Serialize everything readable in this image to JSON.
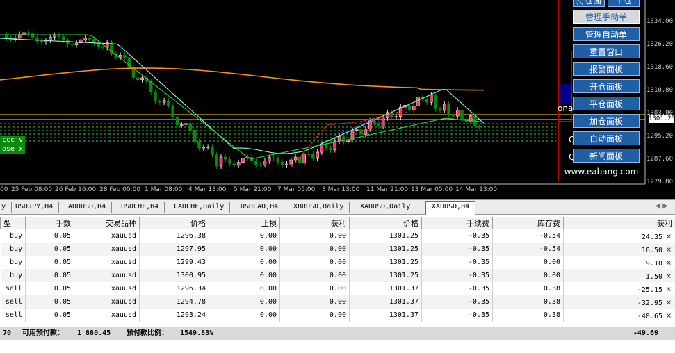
{
  "chart": {
    "price_ticks": [
      "1334.00",
      "1326.20",
      "1318.60",
      "1310.80",
      "1303.00",
      "1295.20",
      "1287.60",
      "1279.80"
    ],
    "current_price": "1301.25",
    "time_ticks": [
      "00",
      "25 Feb 08:00",
      "26 Feb 16:00",
      "28 Feb 00:00",
      "1 Mar 08:00",
      "4 Mar 13:00",
      "5 Mar 21:00",
      "7 Mar 05:00",
      "8 Mar 13:00",
      "11 Mar 21:00",
      "13 Mar 05:00",
      "14 Mar 13:00"
    ],
    "green_tag_top": "ccc v",
    "green_tag_bottom": "ose x",
    "colors": {
      "up": "#e8e8e8",
      "down": "#0a8a0a",
      "ma_fast": "#7fffd4",
      "ma_mid": "#32cd32",
      "ma_slow": "#ff8c1a",
      "level": "#ffd700"
    }
  },
  "panel": {
    "top_buttons": [
      "持仓面",
      "平仓"
    ],
    "buttons": [
      "管理手动单",
      "管理自动单",
      "重置窗口",
      "报警面板",
      "开仓面板",
      "平仓面板",
      "加仓面板",
      "自动面板",
      "新闻面板"
    ],
    "side_text_1": "ona",
    "side_text_2": "Q",
    "side_text_3": "Q",
    "url": "www.eabang.com"
  },
  "tabs": [
    "y",
    "USDJPY,H4",
    "AUDUSD,H4",
    "USDCHF,H4",
    "CADCHF,Daily",
    "USDCAD,H4",
    "XBRUSD,Daily",
    "XAUUSD,Daily",
    "XAUUSD,H4"
  ],
  "tab_arrows": "◀ ▶",
  "table": {
    "columns": [
      "型",
      "手数",
      "交易品种",
      "价格",
      "止损",
      "获利",
      "价格",
      "手续费",
      "库存费",
      "获利"
    ],
    "rows": [
      [
        "buy",
        "0.05",
        "xauusd",
        "1296.38",
        "0.00",
        "0.00",
        "1301.25",
        "-0.35",
        "-0.54",
        "24.35"
      ],
      [
        "buy",
        "0.05",
        "xauusd",
        "1297.95",
        "0.00",
        "0.00",
        "1301.25",
        "-0.35",
        "-0.54",
        "16.50"
      ],
      [
        "buy",
        "0.05",
        "xauusd",
        "1299.43",
        "0.00",
        "0.00",
        "1301.25",
        "-0.35",
        "0.00",
        "9.10"
      ],
      [
        "buy",
        "0.05",
        "xauusd",
        "1300.95",
        "0.00",
        "0.00",
        "1301.25",
        "-0.35",
        "0.00",
        "1.50"
      ],
      [
        "sell",
        "0.05",
        "xauusd",
        "1296.34",
        "0.00",
        "0.00",
        "1301.37",
        "-0.35",
        "0.38",
        "-25.15"
      ],
      [
        "sell",
        "0.05",
        "xauusd",
        "1294.78",
        "0.00",
        "0.00",
        "1301.37",
        "-0.35",
        "0.38",
        "-32.95"
      ],
      [
        "sell",
        "0.05",
        "xauusd",
        "1293.24",
        "0.00",
        "0.00",
        "1301.37",
        "-0.35",
        "0.38",
        "-40.65"
      ]
    ],
    "close_glyph": "×"
  },
  "status": {
    "prefix": "70",
    "free_margin_label": "可用预付款：",
    "free_margin": "1 880.45",
    "margin_level_label": "预付款比例：",
    "margin_level": "1549.83%",
    "total_profit": "-49.69"
  }
}
